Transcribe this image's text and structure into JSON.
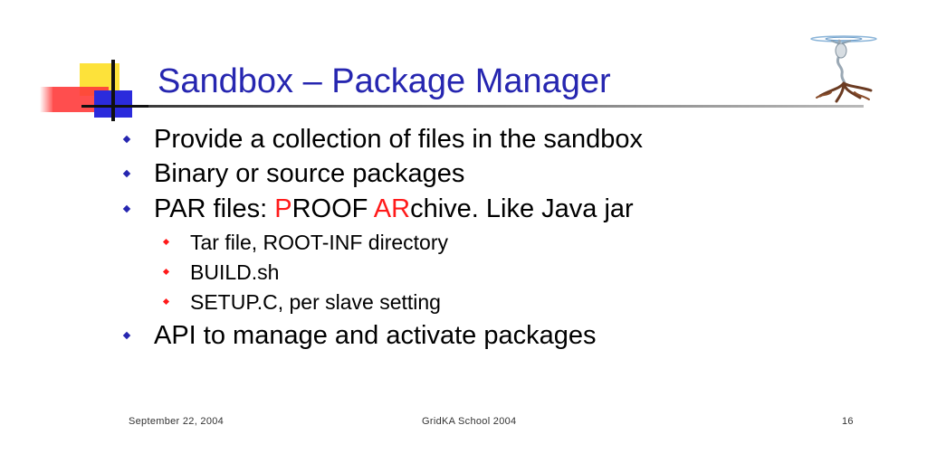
{
  "title": "Sandbox – Package Manager",
  "bullets": {
    "b1": "Provide a collection of files in the sandbox",
    "b2": "Binary or source packages",
    "b3": {
      "pre": "PAR files: ",
      "p": "P",
      "roof": "ROOF ",
      "ar": "AR",
      "post": "chive. Like Java jar"
    },
    "sub1": "Tar file, ROOT-INF directory",
    "sub2": "BUILD.sh",
    "sub3": "SETUP.C, per slave setting",
    "b4": "API to manage and activate packages"
  },
  "footer": {
    "date": "September 22, 2004",
    "event": "GridKA School 2004",
    "page": "16"
  },
  "colors": {
    "title": "#2626b0",
    "accent_red": "#ff1a1a",
    "bullet_blue": "#2626b0",
    "bullet_red": "#ff1a1a"
  }
}
